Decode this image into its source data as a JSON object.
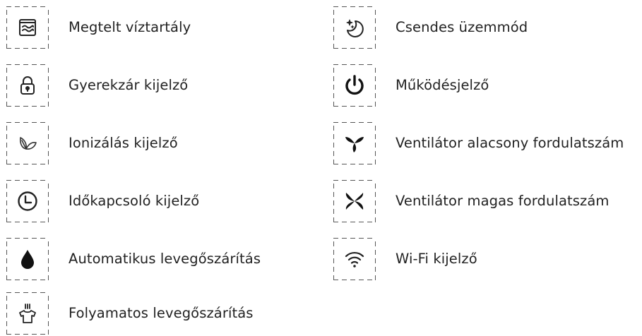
{
  "left_items": [
    {
      "icon": "water-tank-icon",
      "label": "Megtelt víztartály"
    },
    {
      "icon": "lock-icon",
      "label": "Gyerekzár kijelző"
    },
    {
      "icon": "leaf-icon",
      "label": "Ionizálás kijelző"
    },
    {
      "icon": "clock-icon",
      "label": "Időkapcsoló kijelző"
    },
    {
      "icon": "water-drop-icon",
      "label": "Automatikus levegőszárítás"
    },
    {
      "icon": "shirt-steam-icon",
      "label": "Folyamatos levegőszárítás"
    }
  ],
  "right_items": [
    {
      "icon": "moon-stars-icon",
      "label": "Csendes üzemmód"
    },
    {
      "icon": "power-icon",
      "label": "Működésjelző"
    },
    {
      "icon": "fan-low-icon",
      "label": "Ventilátor alacsony fordulatszám"
    },
    {
      "icon": "fan-high-icon",
      "label": "Ventilátor magas fordulatszám"
    },
    {
      "icon": "wifi-icon",
      "label": "Wi-Fi kijelző"
    }
  ]
}
